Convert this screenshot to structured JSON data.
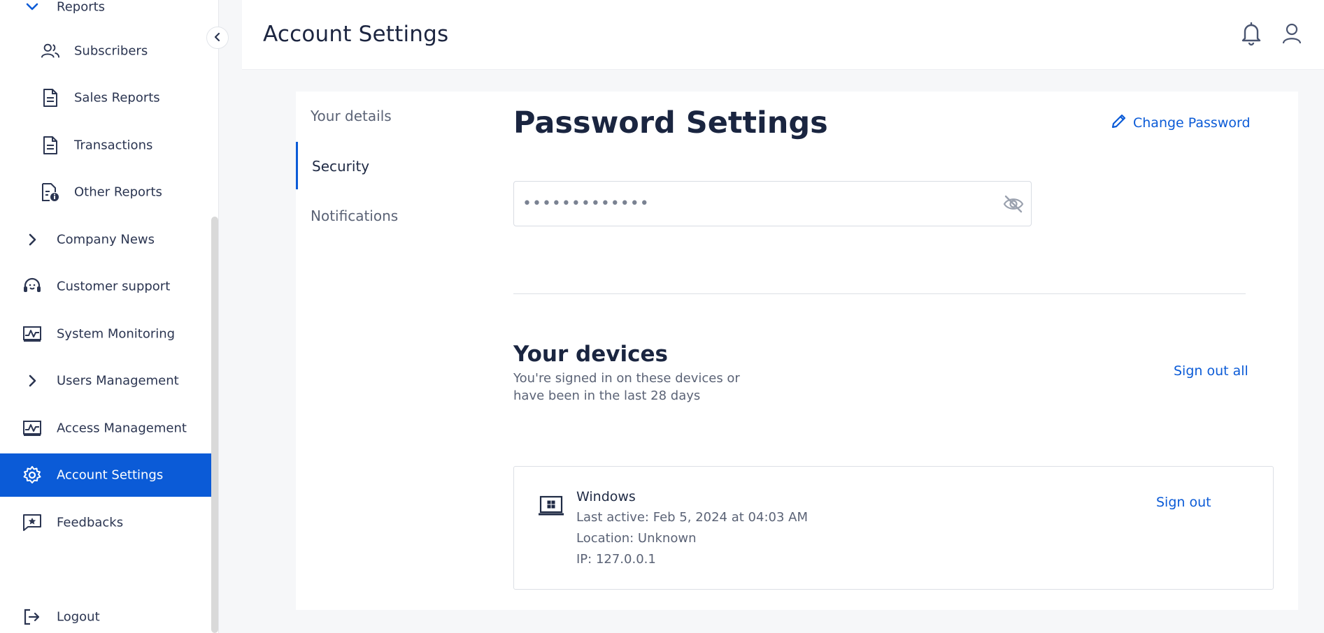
{
  "sidebar": {
    "items": [
      {
        "label": "Reports",
        "icon": "chevron-down-icon"
      },
      {
        "label": "Subscribers",
        "icon": "users-icon"
      },
      {
        "label": "Sales Reports",
        "icon": "document-icon"
      },
      {
        "label": "Transactions",
        "icon": "document-icon"
      },
      {
        "label": "Other Reports",
        "icon": "document-info-icon"
      },
      {
        "label": "Company News",
        "icon": "chevron-right-icon"
      },
      {
        "label": "Customer support",
        "icon": "headset-icon"
      },
      {
        "label": "System Monitoring",
        "icon": "monitor-chart-icon"
      },
      {
        "label": "Users Management",
        "icon": "chevron-right-icon"
      },
      {
        "label": "Access Management",
        "icon": "monitor-chart-icon"
      },
      {
        "label": "Account Settings",
        "icon": "gear-icon"
      },
      {
        "label": "Feedbacks",
        "icon": "star-message-icon"
      },
      {
        "label": "Logout",
        "icon": "logout-icon"
      }
    ]
  },
  "header": {
    "title": "Account Settings"
  },
  "tabs": [
    {
      "label": "Your details"
    },
    {
      "label": "Security"
    },
    {
      "label": "Notifications"
    }
  ],
  "password": {
    "title": "Password Settings",
    "change_label": "Change Password",
    "masked_value": "•••••••••••••"
  },
  "devices": {
    "title": "Your devices",
    "subtitle": "You're signed in on these devices or have been in the last 28 days",
    "sign_out_all": "Sign out all",
    "list": [
      {
        "name": "Windows",
        "last_active": "Last active: Feb 5, 2024 at 04:03 AM",
        "location": "Location: Unknown",
        "ip": "IP: 127.0.0.1",
        "sign_out": "Sign out"
      }
    ]
  },
  "colors": {
    "accent": "#0b5bd7",
    "text": "#1f2a44",
    "muted": "#5b6376",
    "background": "#f6f7f9"
  }
}
